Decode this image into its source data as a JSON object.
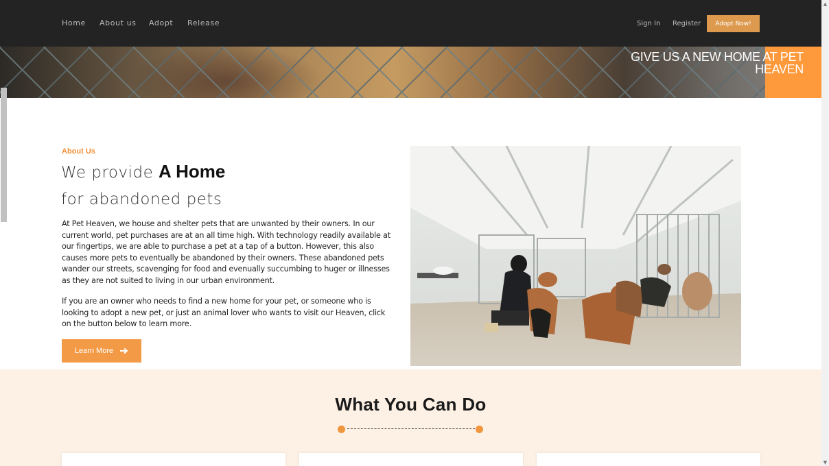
{
  "nav": {
    "links": [
      "Home",
      "About us",
      "Adopt",
      "Release"
    ],
    "sign_in": "Sign In",
    "register": "Register",
    "cta": "Adopt Now!"
  },
  "hero": {
    "tagline_line1": "GIVE US A NEW HOME AT PET",
    "tagline_line2": "HEAVEN",
    "accent_color": "#ff9a3c"
  },
  "about": {
    "kicker": "About Us",
    "heading_light_1": "We provide ",
    "heading_bold": "A Home",
    "heading_light_2": "for abandoned pets",
    "paragraph_1": "At Pet Heaven, we house and shelter pets that are unwanted by their owners. In our current world, pet purchases are at an all time high. With technology readily available at our fingertips, we are able to purchase a pet at a tap of a button. However, this also causes more pets to eventually be abandoned by their owners. These abandoned pets wander our streets, scavenging for food and evenually succumbing to huger or illnesses as they are not suited to living in our urban environment.",
    "paragraph_2": "If you are an owner who needs to find a new home for your pet, or someone who is looking to adopt a new pet, or just an animal lover who wants to visit our Heaven, click on the button below to learn more.",
    "button_label": "Learn More",
    "button_icon": "arrow-right-icon",
    "photo": "shelter-photo"
  },
  "what_you_can_do": {
    "title": "What You Can Do"
  },
  "colors": {
    "brand_orange": "#f39a47",
    "nav_bg": "#232323",
    "section_bg": "#fdf0e4"
  }
}
